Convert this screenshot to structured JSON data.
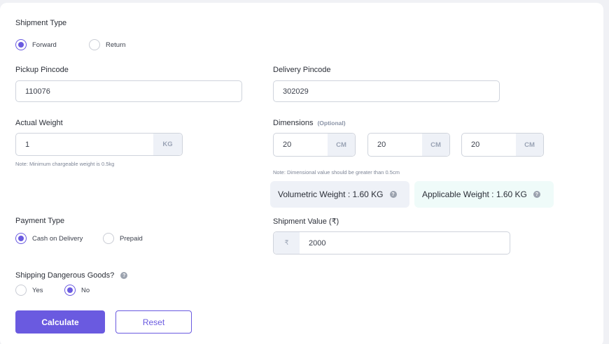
{
  "shipment_type": {
    "label": "Shipment Type",
    "options": [
      {
        "label": "Forward",
        "selected": true
      },
      {
        "label": "Return",
        "selected": false
      }
    ]
  },
  "pickup": {
    "label": "Pickup Pincode",
    "value": "110076"
  },
  "delivery": {
    "label": "Delivery Pincode",
    "value": "302029"
  },
  "weight": {
    "label": "Actual Weight",
    "value": "1",
    "unit": "KG",
    "note": "Note: Minimum chargeable weight is 0.5kg"
  },
  "dimensions": {
    "label": "Dimensions",
    "optional": "(Optional)",
    "fields": [
      {
        "value": "20",
        "unit": "CM"
      },
      {
        "value": "20",
        "unit": "CM"
      },
      {
        "value": "20",
        "unit": "CM"
      }
    ],
    "note": "Note: Dimensional value should be greater than 0.5cm"
  },
  "volumetric_weight": {
    "text": "Volumetric Weight : 1.60 KG",
    "bg": "#eef1f7"
  },
  "applicable_weight": {
    "text": "Applicable Weight : 1.60 KG",
    "bg": "#effbf9"
  },
  "payment_type": {
    "label": "Payment Type",
    "options": [
      {
        "label": "Cash on Delivery",
        "selected": true
      },
      {
        "label": "Prepaid",
        "selected": false
      }
    ]
  },
  "shipment_value": {
    "label": "Shipment Value (₹)",
    "prefix": "₹",
    "value": "2000"
  },
  "dangerous_goods": {
    "label": "Shipping Dangerous Goods?",
    "options": [
      {
        "label": "Yes",
        "selected": false
      },
      {
        "label": "No",
        "selected": true
      }
    ]
  },
  "help_icon_glyph": "?",
  "buttons": {
    "calculate": "Calculate",
    "reset": "Reset"
  },
  "colors": {
    "accent": "#6a5ae0",
    "page_bg": "#f0f1f5"
  }
}
